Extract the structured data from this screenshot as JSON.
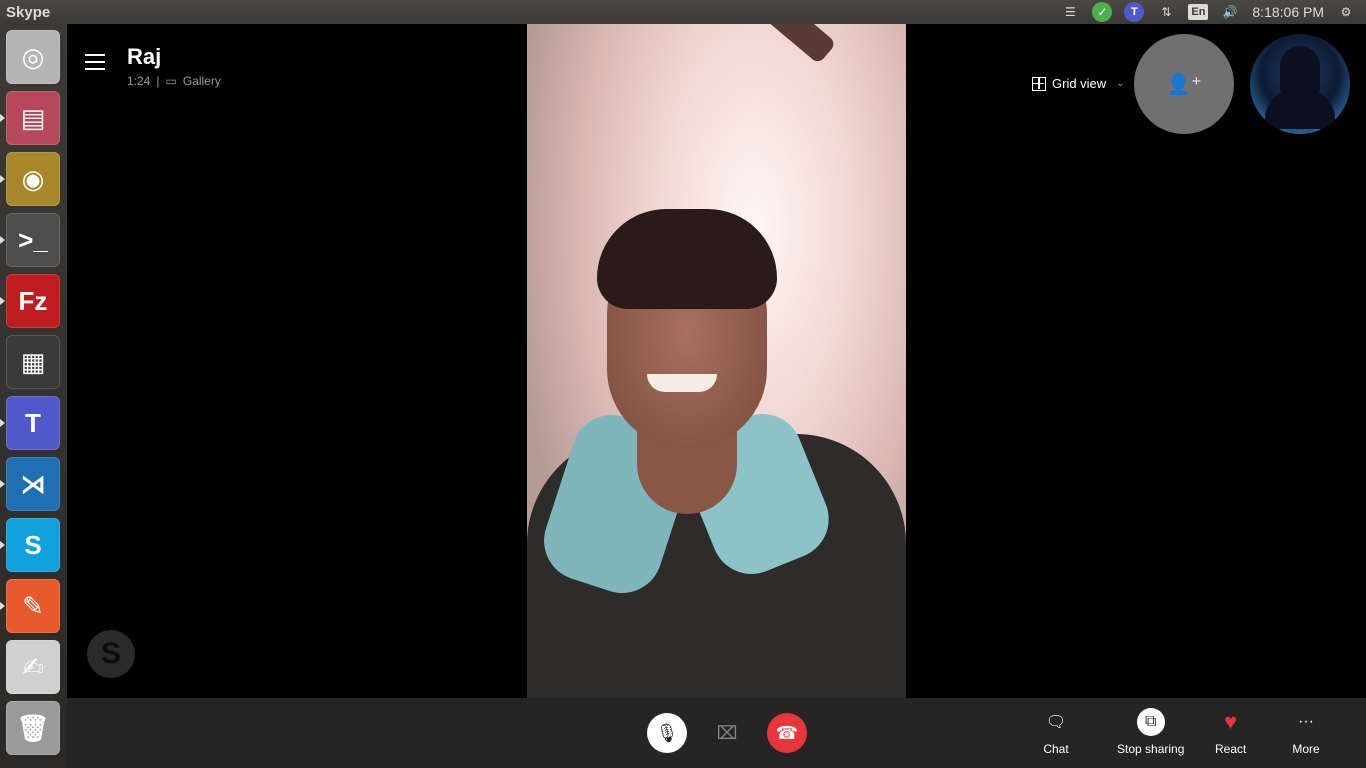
{
  "topbar": {
    "app_name": "Skype",
    "clock": "8:18:06 PM",
    "lang": "En",
    "icons": [
      "menu-list-icon",
      "check-icon",
      "teams-icon",
      "network-icon",
      "language-icon",
      "volume-icon",
      "settings-icon"
    ]
  },
  "launcher": {
    "items": [
      {
        "name": "ubuntu-dash",
        "color": "#b4b4b4",
        "glyph": "◎"
      },
      {
        "name": "files",
        "color": "#b5495b",
        "glyph": "▤"
      },
      {
        "name": "chrome",
        "color": "#a7872a",
        "glyph": "◉"
      },
      {
        "name": "terminal",
        "color": "#4d4d4d",
        "glyph": ">_"
      },
      {
        "name": "filezilla",
        "color": "#bf1c1f",
        "glyph": "Fz"
      },
      {
        "name": "workspace-switcher",
        "color": "#3a3a3a",
        "glyph": "▦"
      },
      {
        "name": "teams",
        "color": "#5059c9",
        "glyph": "T"
      },
      {
        "name": "vscode",
        "color": "#1f6fb2",
        "glyph": "⋊"
      },
      {
        "name": "skype",
        "color": "#0fa0dd",
        "glyph": "S"
      },
      {
        "name": "postman",
        "color": "#e8592b",
        "glyph": "✎"
      },
      {
        "name": "text-editor",
        "color": "#d0d0d0",
        "glyph": "✍"
      },
      {
        "name": "trash",
        "color": "#9a9a9a",
        "glyph": "🗑"
      }
    ]
  },
  "call": {
    "caller_name": "Raj",
    "duration": "1:24",
    "separator": "|",
    "view_mode": "Gallery",
    "grid_view_label": "Grid view",
    "chevron": "⌄"
  },
  "controls": {
    "chat_label": "Chat",
    "stop_sharing_label": "Stop sharing",
    "react_label": "React",
    "more_label": "More"
  },
  "colors": {
    "accent_hangup": "#e8343b",
    "control_bar": "#252525",
    "background": "#000000"
  }
}
